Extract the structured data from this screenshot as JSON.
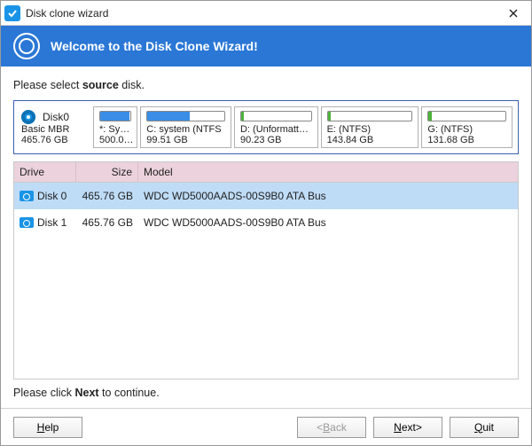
{
  "window": {
    "title": "Disk clone wizard"
  },
  "banner": {
    "title": "Welcome to the Disk Clone Wizard!"
  },
  "instruction_pre": "Please select ",
  "instruction_bold": "source",
  "instruction_post": " disk.",
  "disk_summary": {
    "name": "Disk0",
    "type": "Basic MBR",
    "size": "465.76 GB"
  },
  "partitions": [
    {
      "name": "*: Sys…",
      "size": "500.0…",
      "fill_pct": 95,
      "fill_color": "blue",
      "flex": 9
    },
    {
      "name": "C: system (NTFS",
      "size": "99.51 GB",
      "fill_pct": 55,
      "fill_color": "blue",
      "flex": 22
    },
    {
      "name": "D: (Unformatt…",
      "size": "90.23 GB",
      "fill_pct": 4,
      "fill_color": "green",
      "flex": 20
    },
    {
      "name": "E: (NTFS)",
      "size": "143.84 GB",
      "fill_pct": 4,
      "fill_color": "green",
      "flex": 24
    },
    {
      "name": "G: (NTFS)",
      "size": "131.68 GB",
      "fill_pct": 4,
      "fill_color": "green",
      "flex": 22
    }
  ],
  "table": {
    "headers": {
      "drive": "Drive",
      "size": "Size",
      "model": "Model"
    },
    "rows": [
      {
        "drive": "Disk 0",
        "size": "465.76 GB",
        "model": "WDC WD5000AADS-00S9B0 ATA Bus",
        "selected": true
      },
      {
        "drive": "Disk 1",
        "size": "465.76 GB",
        "model": "WDC WD5000AADS-00S9B0 ATA Bus",
        "selected": false
      }
    ]
  },
  "hint_pre": "Please click ",
  "hint_bold": "Next",
  "hint_post": " to continue.",
  "buttons": {
    "help": "Help",
    "back": "Back",
    "next": "Next",
    "quit": "Quit"
  },
  "buttons_accel": {
    "help": "H",
    "back": "B",
    "next": "N",
    "quit": "Q"
  },
  "state": {
    "back_enabled": false
  }
}
